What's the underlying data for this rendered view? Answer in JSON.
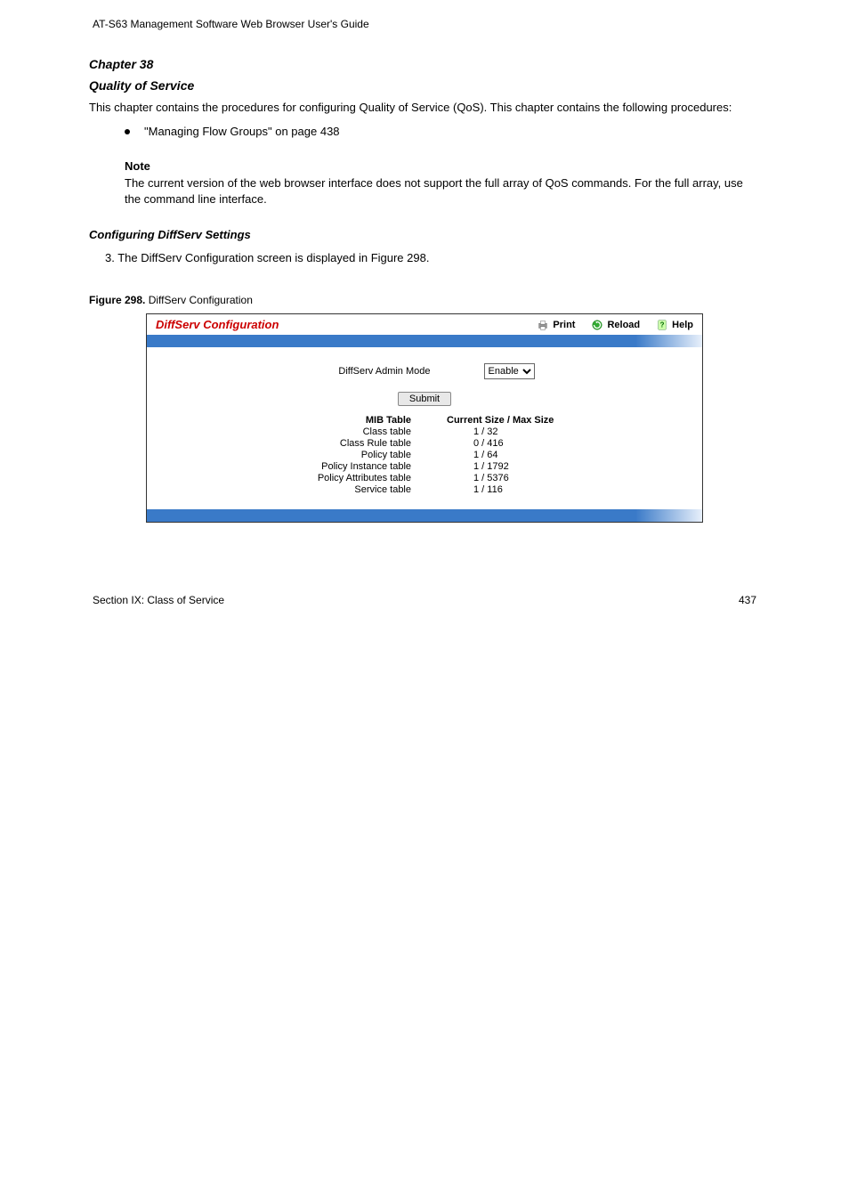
{
  "header": {
    "left": "AT-S63 Management Software Web Browser User's Guide",
    "section_num": "Section IX: Class of Service",
    "page_num": "437"
  },
  "chapter": {
    "title": "Chapter 38",
    "name": "Quality of Service"
  },
  "intro": "This chapter contains the procedures for configuring Quality of Service (QoS). This chapter contains the following procedures:",
  "toc": "\"Managing Flow Groups\" on page 438",
  "note_label": "Note",
  "note_text": "The current version of the web browser interface does not support the full array of QoS commands. For the full array, use the command line interface.",
  "section2": {
    "title": "Configuring DiffServ Settings",
    "num_label": "3.",
    "num_text": "The DiffServ Configuration screen is displayed in Figure 298."
  },
  "figure": {
    "label": "Figure 298.",
    "caption": "DiffServ Configuration"
  },
  "panel": {
    "title": "DiffServ Configuration",
    "links": {
      "print": "Print",
      "reload": "Reload",
      "help": "Help"
    },
    "form": {
      "label": "DiffServ Admin Mode",
      "select_value": "Enable"
    },
    "submit": "Submit",
    "table": {
      "header_left": "MIB Table",
      "header_right": "Current Size / Max Size",
      "rows": [
        {
          "name": "Class table",
          "value": "1 / 32"
        },
        {
          "name": "Class Rule table",
          "value": "0 / 416"
        },
        {
          "name": "Policy table",
          "value": "1 / 64"
        },
        {
          "name": "Policy Instance table",
          "value": "1 / 1792"
        },
        {
          "name": "Policy Attributes table",
          "value": "1 / 5376"
        },
        {
          "name": "Service table",
          "value": "1 / 116"
        }
      ]
    }
  }
}
